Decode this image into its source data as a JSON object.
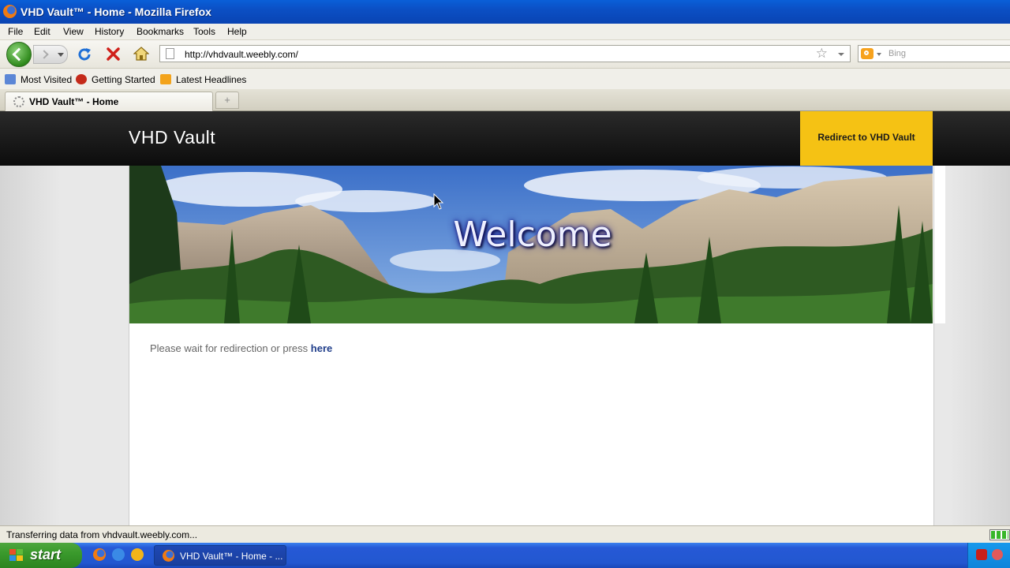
{
  "window": {
    "title": "VHD Vault™ - Home - Mozilla Firefox"
  },
  "menu": [
    "File",
    "Edit",
    "View",
    "History",
    "Bookmarks",
    "Tools",
    "Help"
  ],
  "nav": {
    "url": "http://vhdvault.weebly.com/",
    "search_placeholder": "Bing"
  },
  "bookmarks": [
    "Most Visited",
    "Getting Started",
    "Latest Headlines"
  ],
  "tabs": [
    {
      "label": "VHD Vault™ - Home"
    }
  ],
  "new_tab_symbol": "+",
  "site": {
    "brand": "VHD Vault",
    "cta": "Redirect to VHD Vault",
    "banner_text": "Welcome",
    "message": "Please wait for redirection or press",
    "link": "here"
  },
  "status": {
    "text": "Transferring data from vhdvault.weebly.com..."
  },
  "taskbar": {
    "start_label": "start",
    "task_button": "VHD Vault™ - Home - ..."
  },
  "colors": {
    "cta_bg": "#f5c214",
    "titlebar": "#0b4fc4",
    "taskbar": "#2257d0",
    "start": "#3a9a2c"
  }
}
